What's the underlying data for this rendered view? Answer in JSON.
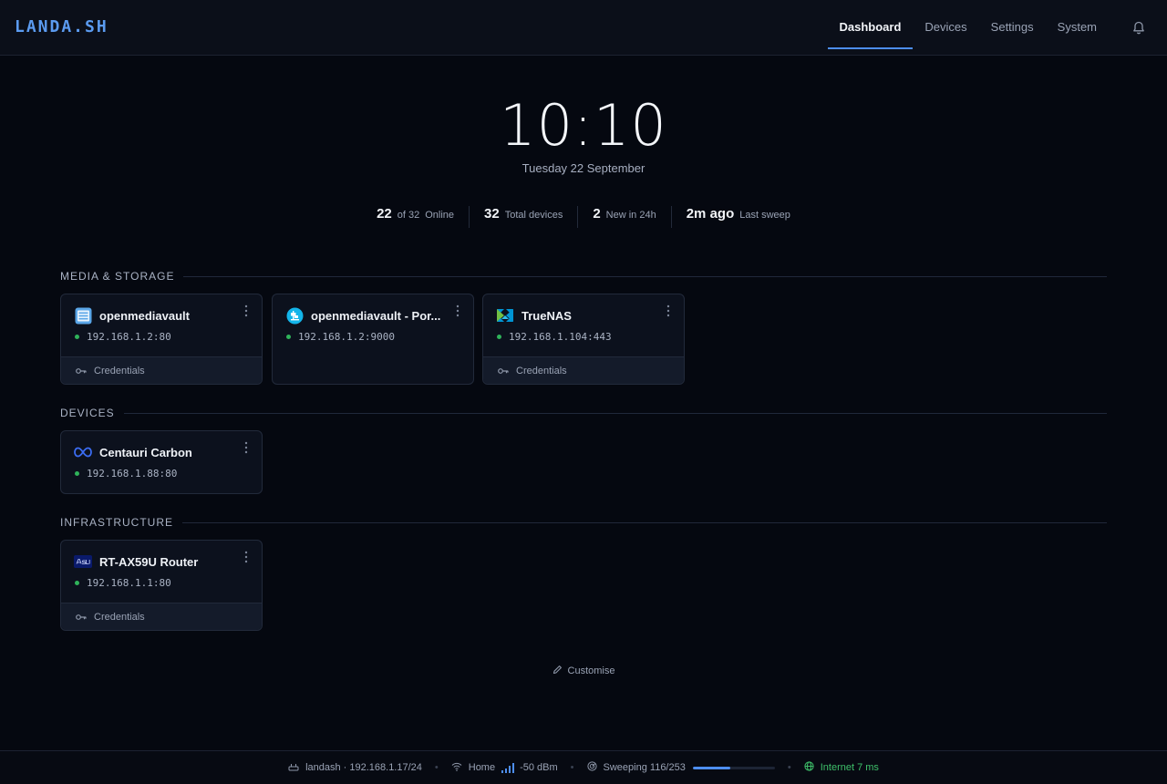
{
  "brand": "LANDA.SH",
  "nav": {
    "tabs": [
      {
        "label": "Dashboard",
        "active": true
      },
      {
        "label": "Devices",
        "active": false
      },
      {
        "label": "Settings",
        "active": false
      },
      {
        "label": "System",
        "active": false
      }
    ],
    "bell_icon": "bell-icon"
  },
  "clock": {
    "time": "10:10",
    "date": "Tuesday 22 September"
  },
  "stats": {
    "online_count": "22",
    "online_of": "of 32",
    "online_label": "Online",
    "total_count": "32",
    "total_label": "Total devices",
    "new_count": "2",
    "new_label": "New in 24h",
    "sweep_value": "2m ago",
    "sweep_label": "Last sweep"
  },
  "sections": {
    "media": {
      "label": "MEDIA & STORAGE",
      "cards": [
        {
          "name": "openmediavault",
          "address": "192.168.1.2:80",
          "icon": "openmediavault-icon",
          "credentials": "Credentials"
        },
        {
          "name": "openmediavault - Por...",
          "address": "192.168.1.2:9000",
          "icon": "portainer-icon"
        },
        {
          "name": "TrueNAS",
          "address": "192.168.1.104:443",
          "icon": "truenas-icon",
          "credentials": "Credentials"
        }
      ]
    },
    "devices": {
      "label": "DEVICES",
      "cards": [
        {
          "name": "Centauri Carbon",
          "address": "192.168.1.88:80",
          "icon": "infinity-icon"
        }
      ]
    },
    "infrastructure": {
      "label": "INFRASTRUCTURE",
      "cards": [
        {
          "name": "RT-AX59U Router",
          "address": "192.168.1.1:80",
          "icon": "asus-icon",
          "credentials": "Credentials"
        }
      ]
    }
  },
  "customise": "Customise",
  "footer": {
    "host": "landash · 192.168.1.17/24",
    "wifi_name": "Home",
    "signal": "-50 dBm",
    "sweeping": "Sweeping 116/253",
    "sweep_progress": 0.4585,
    "internet": "Internet 7 ms"
  },
  "colors": {
    "accent": "#4d8ef0",
    "online": "#2fb35a",
    "internet": "#3ec06a",
    "background": "#050810"
  }
}
